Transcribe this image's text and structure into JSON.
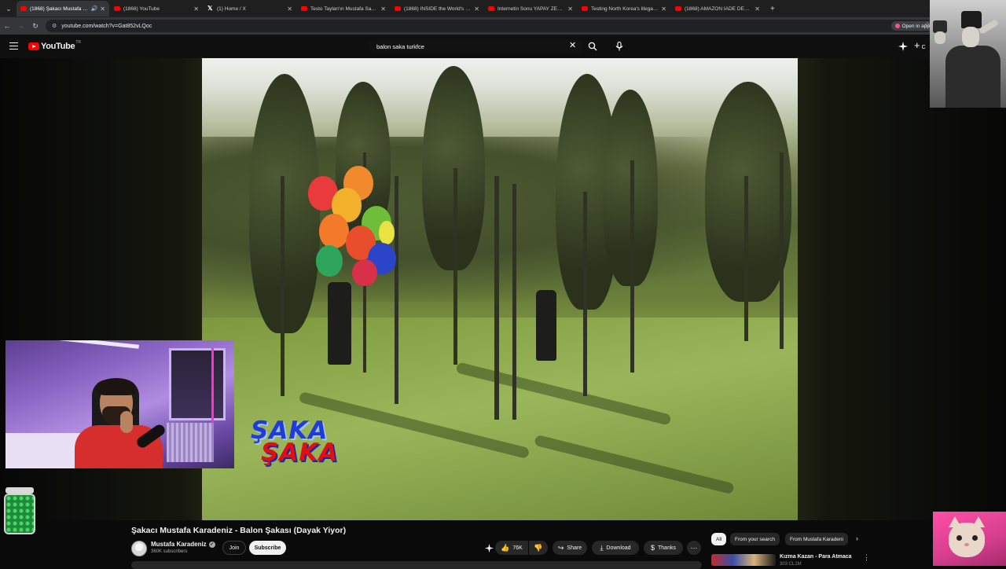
{
  "browser": {
    "tabs": [
      {
        "title": "(1868) Şakacı Mustafa Karadeniz",
        "icon": "youtube-icon",
        "active": true,
        "audio": true
      },
      {
        "title": "(1868) YouTube",
        "icon": "youtube-icon",
        "active": false
      },
      {
        "title": "(1) Home / X",
        "icon": "x-icon",
        "active": false
      },
      {
        "title": "Testo Taylan'ın Mustafa Sangül'e",
        "icon": "youtube-icon",
        "active": false
      },
      {
        "title": "(1868) INSIDE the World's Most",
        "icon": "youtube-icon",
        "active": false
      },
      {
        "title": "İnternetin Sonu YAPAY ZEKA O",
        "icon": "youtube-icon",
        "active": false
      },
      {
        "title": "Testing North Korea's illegal sm",
        "icon": "youtube-icon",
        "active": false
      },
      {
        "title": "(1868) AMAZON İADE DEPOSU",
        "icon": "youtube-icon",
        "active": false
      }
    ],
    "url": "youtube.com/watch?v=Gat852vLQoc",
    "open_in_app": "Open in app"
  },
  "youtube": {
    "logo_text": "YouTube",
    "region": "TR",
    "search_query": "balon saka turkfce",
    "create_label": "C"
  },
  "video": {
    "watermark_line1": "ŞAKA",
    "watermark_line2": "ŞAKA",
    "title": "Şakacı Mustafa Karadeniz - Balon Şakası (Dayak Yiyor)",
    "channel_name": "Mustafa Karadeniz",
    "subscribers": "360K subscribers",
    "join_label": "Join",
    "subscribe_label": "Subscribe",
    "likes": "76K",
    "share_label": "Share",
    "download_label": "Download",
    "thanks_label": "Thanks"
  },
  "filters": {
    "chips": [
      "All",
      "From your search",
      "From Mustafa Karadeni"
    ]
  },
  "recommendation": {
    "title": "Kızma Kazan - Para Atmaca",
    "meta": "303 CL1M"
  },
  "colors": {
    "accent": "#ff0000",
    "background": "#0f0f0f"
  }
}
